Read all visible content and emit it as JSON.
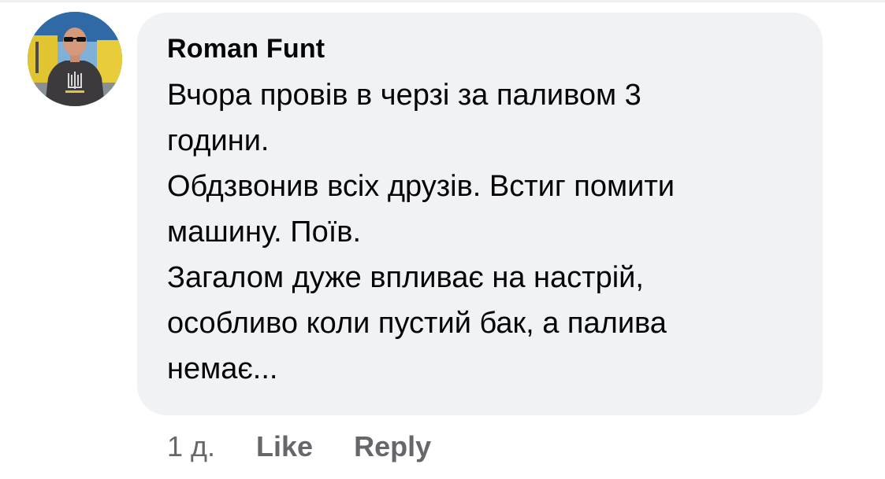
{
  "comment": {
    "author": "Roman Funt",
    "lines": [
      "Вчора провів в черзі за паливом 3",
      "години.",
      "Обдзвонив всіх друзів. Встиг помити",
      "машину. Поїв.",
      "Загалом дуже впливає на настрій,",
      "особливо коли пустий бак, а палива",
      "немає..."
    ]
  },
  "actions": {
    "time": "1 д.",
    "like_label": "Like",
    "reply_label": "Reply"
  },
  "colors": {
    "bubble": "#f0f2f5",
    "text": "#050505",
    "secondary_text": "#65676b"
  }
}
